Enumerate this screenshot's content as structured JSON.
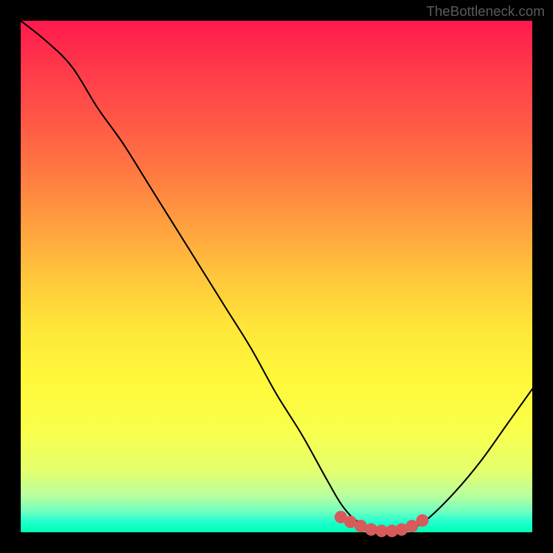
{
  "watermark": "TheBottleneck.com",
  "chart_data": {
    "type": "line",
    "title": "",
    "xlabel": "",
    "ylabel": "",
    "xlim": [
      0,
      100
    ],
    "ylim": [
      0,
      100
    ],
    "series": [
      {
        "name": "curve",
        "x": [
          0,
          5,
          10,
          15,
          20,
          25,
          30,
          35,
          40,
          45,
          50,
          55,
          60,
          63,
          66,
          70,
          74,
          77,
          80,
          85,
          90,
          95,
          100
        ],
        "values": [
          100,
          96,
          91,
          83,
          76,
          68,
          60,
          52,
          44,
          36,
          27,
          19,
          10,
          5,
          2,
          0,
          0,
          1,
          3,
          8,
          14,
          21,
          28
        ]
      }
    ],
    "markers": {
      "name": "highlight",
      "x": [
        62.5,
        64.5,
        66.5,
        68.5,
        70.5,
        72.5,
        74.5,
        76.5,
        78.5
      ],
      "values": [
        3.0,
        2.0,
        1.2,
        0.6,
        0.3,
        0.3,
        0.6,
        1.2,
        2.3
      ]
    },
    "gradient": {
      "top": "#ff1a4d",
      "mid": "#ffe639",
      "bottom": "#00ffb0"
    }
  }
}
